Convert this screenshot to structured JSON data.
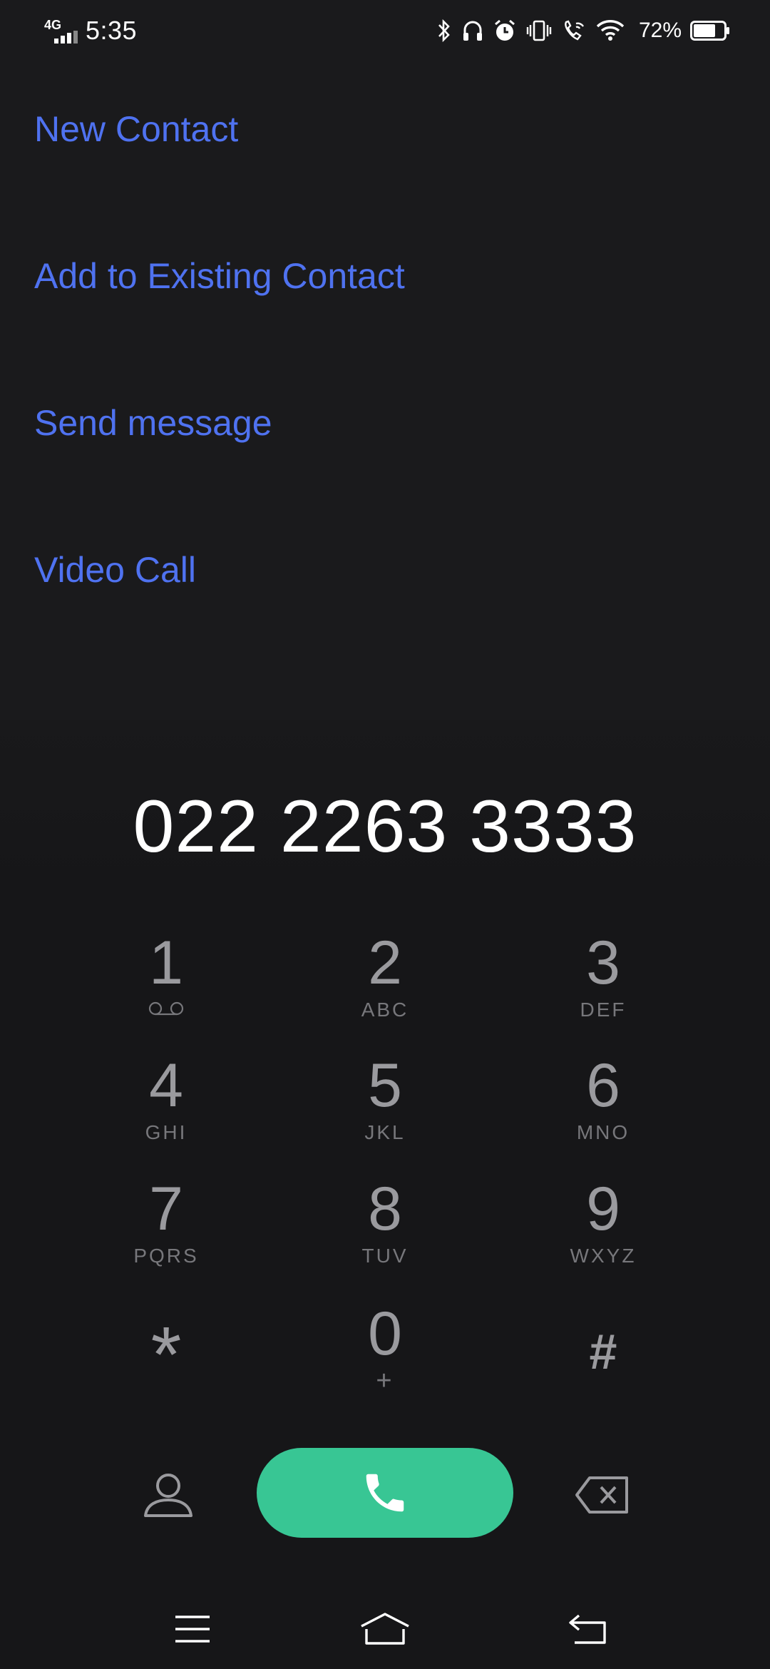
{
  "status_bar": {
    "network_type": "4G",
    "time": "5:35",
    "battery_percent": "72%",
    "battery_level": 0.72,
    "icons": [
      "bluetooth-icon",
      "headphones-icon",
      "alarm-icon",
      "vibrate-icon",
      "wifi-calling-icon",
      "wifi-icon",
      "battery-icon"
    ]
  },
  "menu": {
    "new_contact": "New Contact",
    "add_existing": "Add to Existing Contact",
    "send_message": "Send message",
    "video_call": "Video Call"
  },
  "dialer": {
    "number": "022 2263 3333",
    "keys": [
      {
        "digit": "1",
        "letters": ""
      },
      {
        "digit": "2",
        "letters": "ABC"
      },
      {
        "digit": "3",
        "letters": "DEF"
      },
      {
        "digit": "4",
        "letters": "GHI"
      },
      {
        "digit": "5",
        "letters": "JKL"
      },
      {
        "digit": "6",
        "letters": "MNO"
      },
      {
        "digit": "7",
        "letters": "PQRS"
      },
      {
        "digit": "8",
        "letters": "TUV"
      },
      {
        "digit": "9",
        "letters": "WXYZ"
      },
      {
        "digit": "*",
        "letters": ""
      },
      {
        "digit": "0",
        "letters": "+"
      },
      {
        "digit": "#",
        "letters": ""
      }
    ]
  },
  "colors": {
    "accent_link": "#4f72f0",
    "call_button": "#38c694",
    "background": "#1a1a1c"
  }
}
